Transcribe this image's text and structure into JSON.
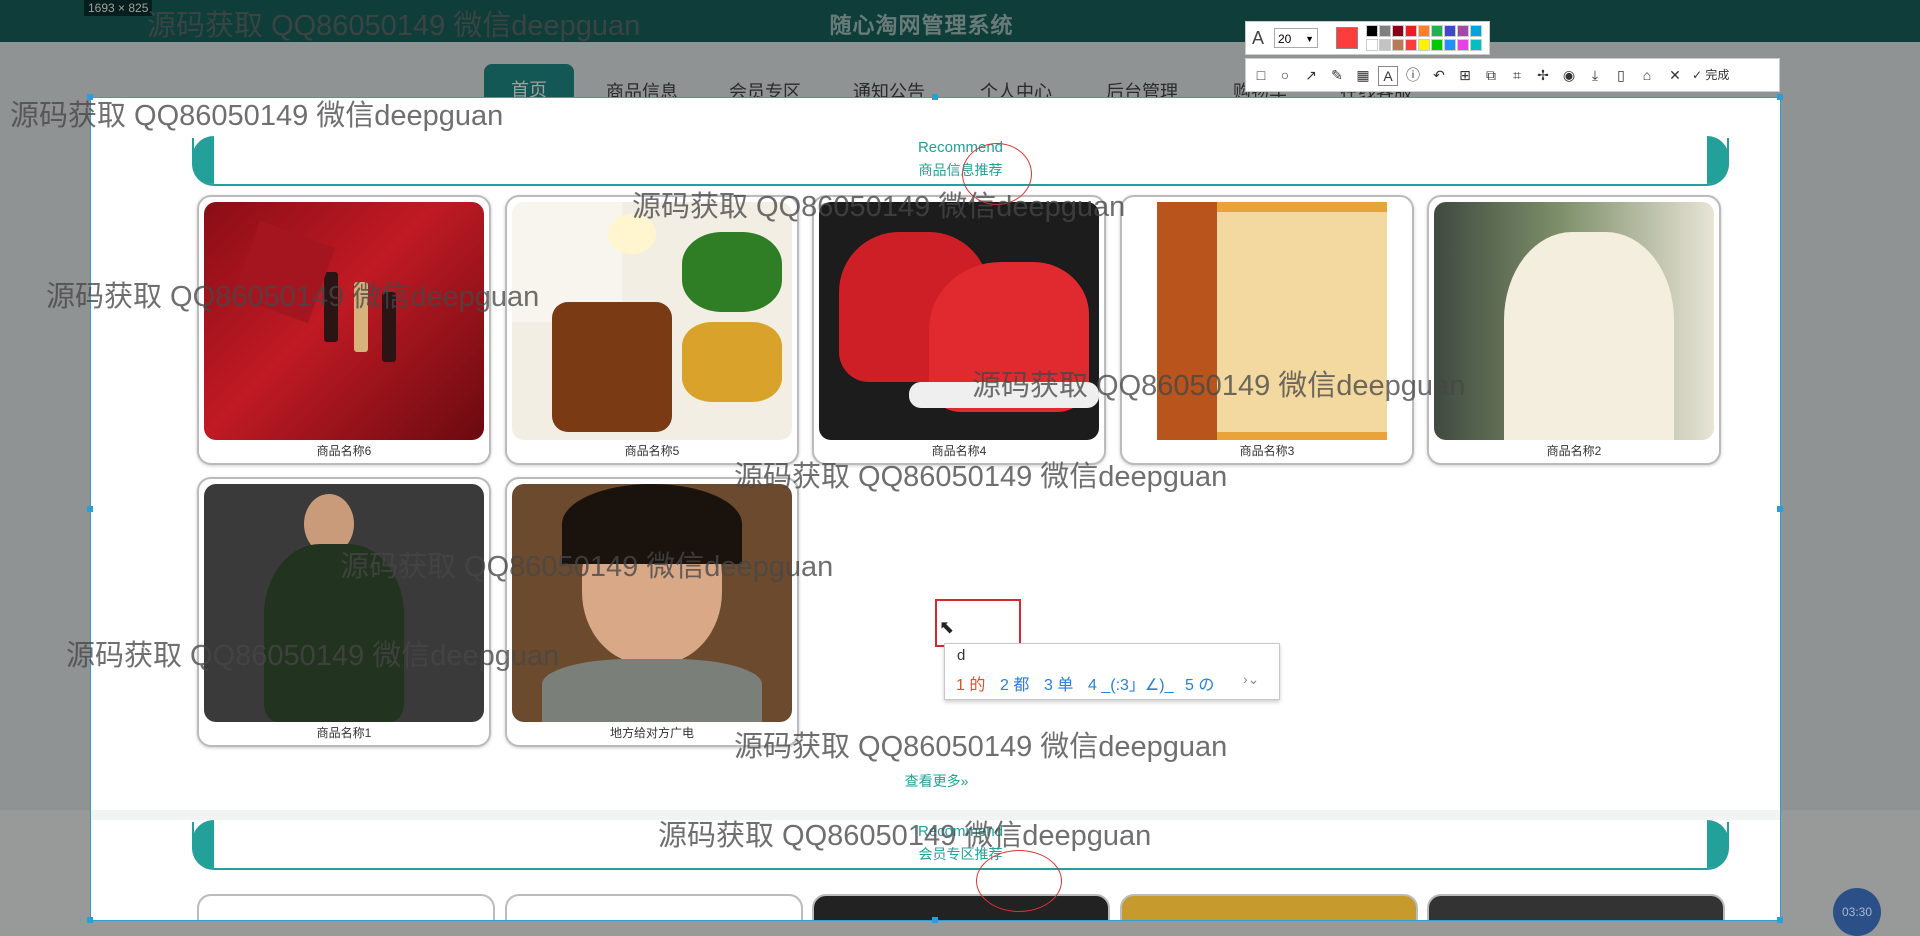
{
  "app": {
    "title": "随心淘网管理系统",
    "size_label": "1693 × 825",
    "timer": "03:30"
  },
  "nav": {
    "items": [
      "首页",
      "商品信息",
      "会员专区",
      "通知公告",
      "个人中心",
      "后台管理",
      "购物车",
      "在线客服"
    ]
  },
  "section1": {
    "en": "Recommend",
    "zh": "商品信息推荐",
    "products": [
      "商品名称6",
      "商品名称5",
      "商品名称4",
      "商品名称3",
      "商品名称2",
      "商品名称1",
      "地方给对方广电"
    ],
    "more": "查看更多»"
  },
  "section2": {
    "en": "Recommend",
    "zh": "会员专区推荐"
  },
  "ime": {
    "input": "d",
    "candidates": [
      "1 的",
      "2 都",
      "3 单",
      "4 _(:3」∠)_",
      "5 の"
    ]
  },
  "toolbar": {
    "font_size": "20",
    "done": "完成",
    "colors": [
      "#000000",
      "#7f7f7f",
      "#880015",
      "#ed1c24",
      "#ff7f27",
      "#22b14c",
      "#3f48cc",
      "#a349a4",
      "#00a2e8",
      "#ffffff",
      "#c3c3c3",
      "#b97a57",
      "#ff3c3c",
      "#fff200",
      "#00c800",
      "#1e90ff",
      "#e640e6",
      "#00c0c0"
    ],
    "current_color": "#ff3c3c"
  },
  "watermark": "源码获取 QQ86050149 微信deepguan"
}
